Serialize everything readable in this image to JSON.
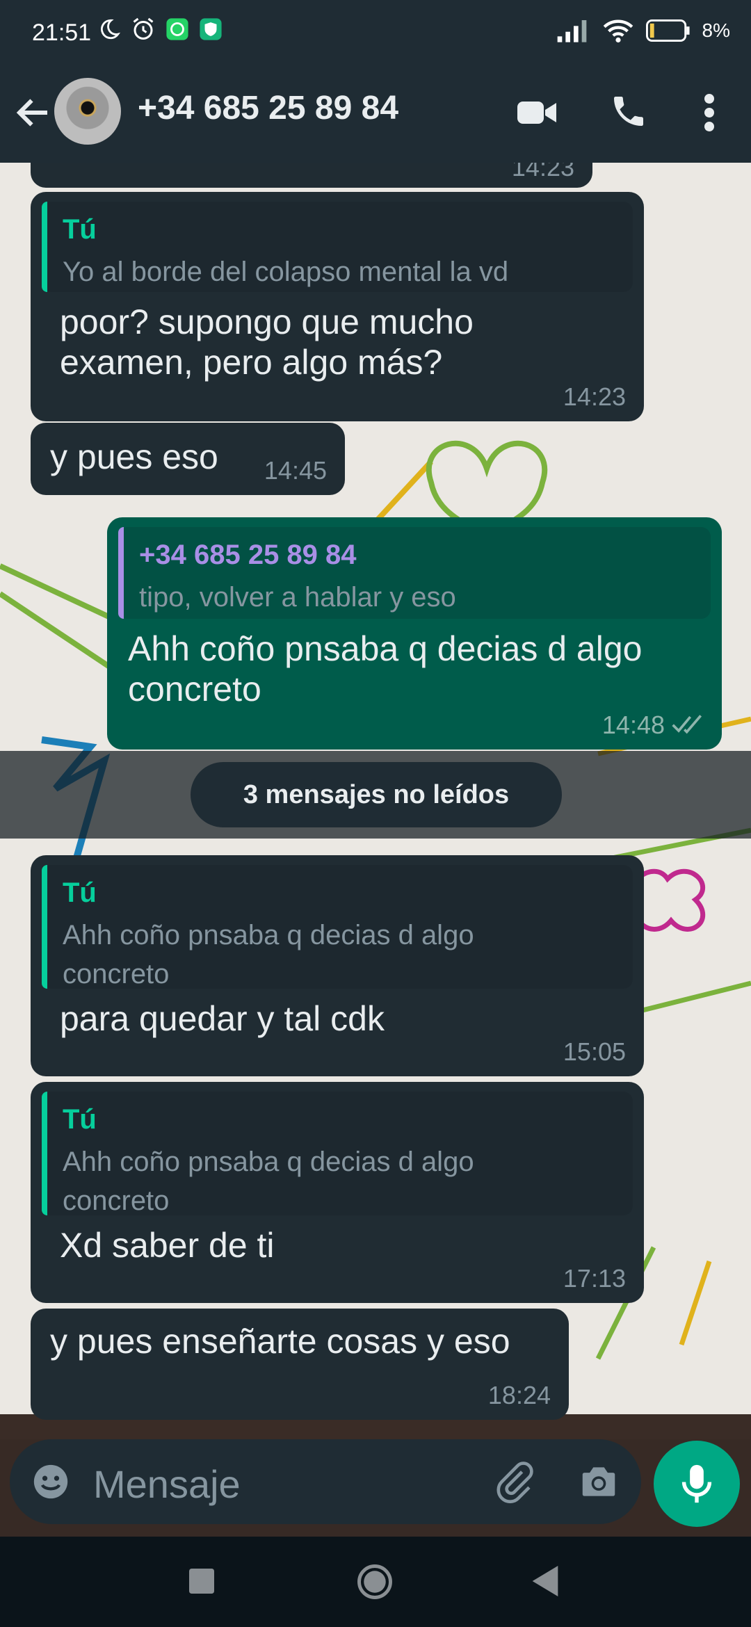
{
  "status_bar": {
    "time": "21:51",
    "battery": "8%"
  },
  "header": {
    "contact": "+34 685 25 89 84"
  },
  "messages": [
    {
      "id": "m0",
      "type": "incoming",
      "text": "",
      "time": "14:23",
      "partial": true
    },
    {
      "id": "m1",
      "type": "incoming",
      "quote_author": "Tú",
      "quote_text": "Yo al borde del colapso mental la vd",
      "text": "poor? supongo que mucho examen, pero algo más?",
      "time": "14:23"
    },
    {
      "id": "m2",
      "type": "incoming",
      "text": "y pues eso",
      "time": "14:45"
    },
    {
      "id": "m3",
      "type": "outgoing",
      "quote_author": "+34 685 25 89 84",
      "quote_text": "tipo, volver a hablar y eso",
      "text": "Ahh coño pnsaba q decias d algo concreto",
      "time": "14:48",
      "status": "read"
    },
    {
      "id": "m4",
      "type": "incoming",
      "quote_author": "Tú",
      "quote_text": "Ahh coño pnsaba q decias d algo concreto",
      "text": "para quedar y tal cdk",
      "time": "15:05"
    },
    {
      "id": "m5",
      "type": "incoming",
      "quote_author": "Tú",
      "quote_text": "Ahh coño pnsaba q decias d algo concreto",
      "text": "Xd saber de ti",
      "time": "17:13"
    },
    {
      "id": "m6",
      "type": "incoming",
      "text": "y pues enseñarte cosas y eso",
      "time": "18:24"
    }
  ],
  "unread_divider": "3 mensajes no leídos",
  "composer": {
    "placeholder": "Mensaje"
  },
  "icons": [
    "back-arrow-icon",
    "video-call-icon",
    "phone-icon",
    "more-options-icon",
    "emoji-icon",
    "attach-icon",
    "camera-icon",
    "mic-icon",
    "recents-icon",
    "home-icon",
    "back-nav-icon"
  ],
  "colors": {
    "app_bar": "#1f2c34",
    "incoming_bubble": "#202c33",
    "outgoing_bubble": "#005c4b",
    "accent": "#00a884",
    "quote_self": "#06cf9c",
    "quote_other": "#a98fe6"
  }
}
